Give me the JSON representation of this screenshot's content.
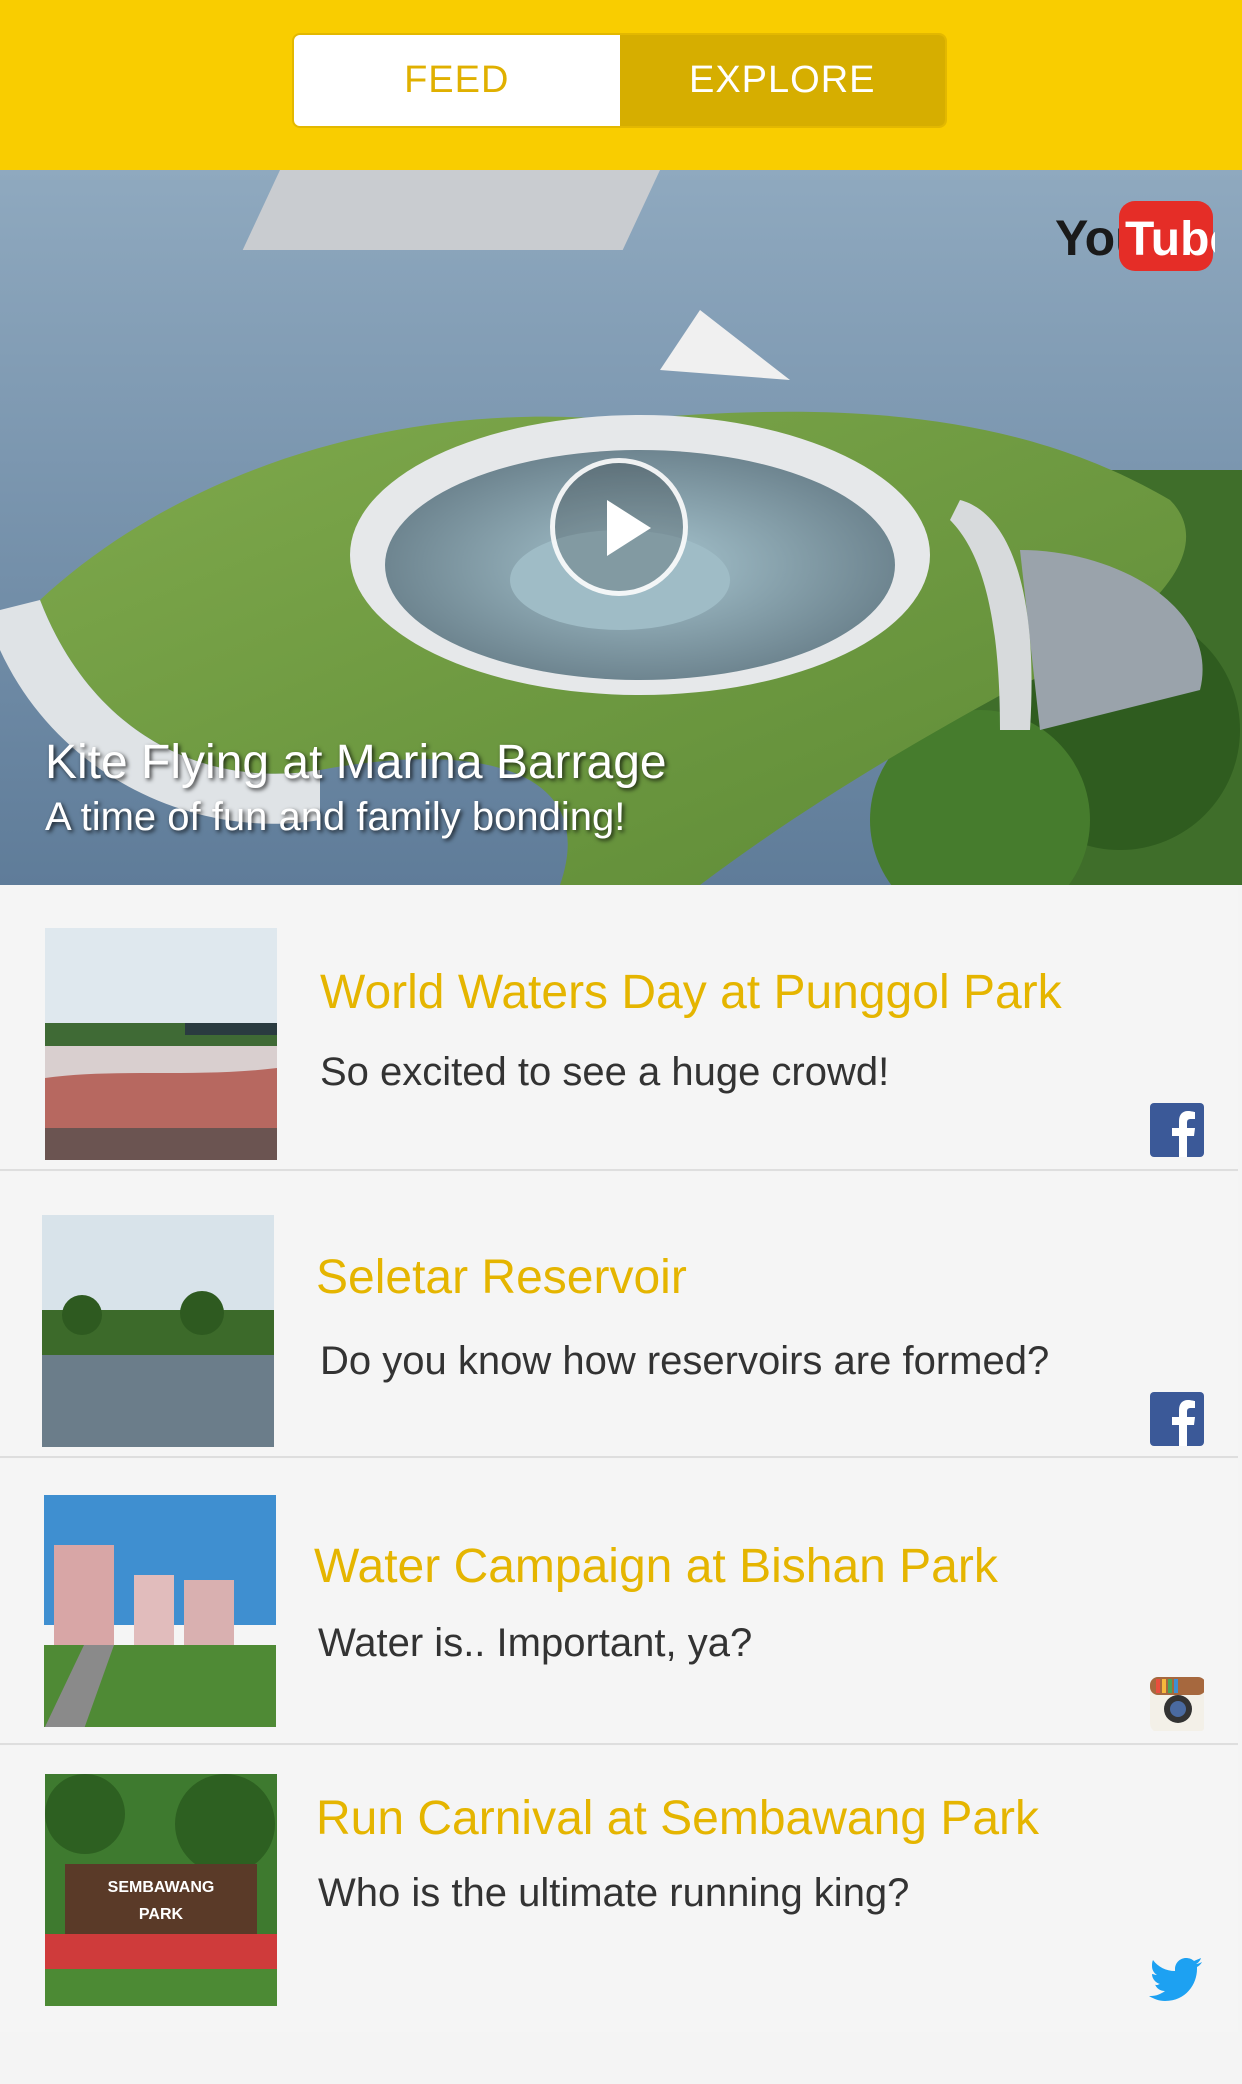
{
  "tabs": [
    {
      "label": "FEED",
      "active": true
    },
    {
      "label": "EXPLORE",
      "active": false
    }
  ],
  "colors": {
    "brand_yellow": "#f9cd00",
    "title_yellow": "#e5b500",
    "text_dark": "#333333",
    "facebook": "#3b5998",
    "twitter": "#1da1f2"
  },
  "hero": {
    "title": "Kite Flying at Marina Barrage",
    "subtitle": "A time of fun and family bonding!",
    "source_logo_text": "You",
    "source_logo_box_text": "Tube",
    "source_icon": "youtube-icon",
    "play_icon": "play-icon"
  },
  "feed": [
    {
      "title": "World Waters Day at Punggol Park",
      "text": "So excited to see a huge crowd!",
      "source": "facebook-icon"
    },
    {
      "title": "Seletar Reservoir",
      "text": "Do you know how reservoirs are formed?",
      "source": "facebook-icon"
    },
    {
      "title": "Water Campaign at Bishan Park",
      "text": "Water is.. Important, ya?",
      "source": "instagram-icon"
    },
    {
      "title": "Run Carnival at Sembawang Park",
      "text": "Who is the ultimate running king?",
      "source": "twitter-icon",
      "thumb_sign_line1": "SEMBAWANG",
      "thumb_sign_line2": "PARK"
    }
  ]
}
